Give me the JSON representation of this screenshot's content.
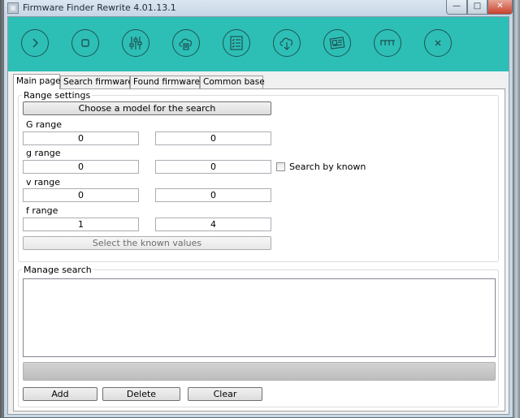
{
  "window": {
    "title": "Firmware Finder Rewrite 4.01.13.1",
    "buttons": {
      "minimize": "—",
      "maximize": "□",
      "close": "✕"
    }
  },
  "toolbar": {
    "color": "#2dbfb6",
    "tools": [
      {
        "name": "start-icon"
      },
      {
        "name": "stop-icon"
      },
      {
        "name": "settings-sliders-icon"
      },
      {
        "name": "cloud-upload-icon"
      },
      {
        "name": "checklist-icon"
      },
      {
        "name": "cloud-download-icon"
      },
      {
        "name": "news-icon"
      },
      {
        "name": "ruler-icon"
      },
      {
        "name": "close-icon"
      }
    ]
  },
  "tabs": [
    {
      "label": "Main page",
      "active": true
    },
    {
      "label": "Search firmware",
      "active": false
    },
    {
      "label": "Found firmwares",
      "active": false
    },
    {
      "label": "Common base",
      "active": false
    }
  ],
  "range_settings": {
    "legend": "Range settings",
    "choose_model_label": "Choose a model for the search",
    "ranges": [
      {
        "label": "G range",
        "from": "0",
        "to": "0"
      },
      {
        "label": "g range",
        "from": "0",
        "to": "0"
      },
      {
        "label": "v range",
        "from": "0",
        "to": "0"
      },
      {
        "label": "f range",
        "from": "1",
        "to": "4"
      }
    ],
    "search_by_known": {
      "label": "Search by known",
      "checked": false
    },
    "select_known_label": "Select the known values"
  },
  "manage_search": {
    "legend": "Manage search",
    "log": "",
    "progress": 0,
    "buttons": {
      "add": "Add",
      "delete": "Delete",
      "clear": "Clear"
    }
  }
}
